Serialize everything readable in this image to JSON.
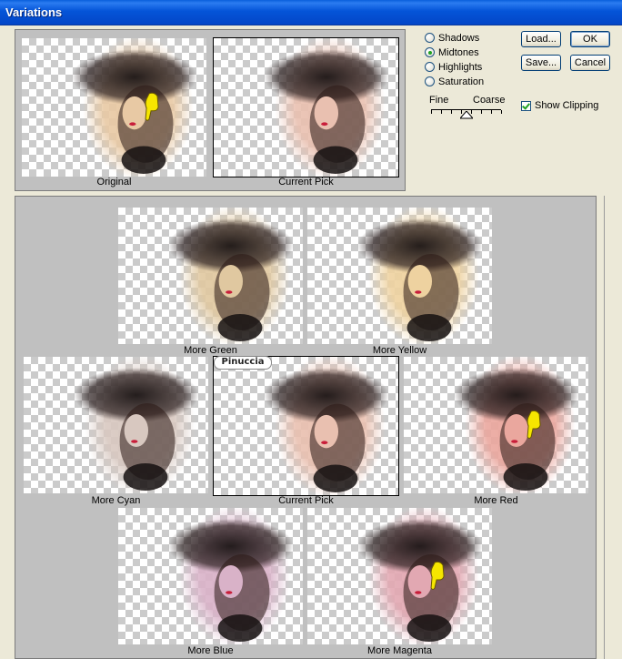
{
  "window": {
    "title": "Variations"
  },
  "preview": {
    "original_label": "Original",
    "current_pick_label": "Current Pick"
  },
  "tones": {
    "options": [
      "Shadows",
      "Midtones",
      "Highlights",
      "Saturation"
    ],
    "selected": "Midtones"
  },
  "slider": {
    "fine_label": "Fine",
    "coarse_label": "Coarse",
    "position": 0.5
  },
  "show_clipping": {
    "label": "Show Clipping",
    "checked": true
  },
  "buttons": {
    "load": "Load...",
    "ok": "OK",
    "save": "Save...",
    "cancel": "Cancel"
  },
  "variations": {
    "more_green": "More Green",
    "more_yellow": "More Yellow",
    "more_cyan": "More Cyan",
    "current_pick": "Current Pick",
    "more_red": "More Red",
    "more_blue": "More Blue",
    "more_magenta": "More Magenta"
  },
  "watermark": "Pinuccia",
  "tints": {
    "original": "#e8c9a4",
    "current": "#e9c0b0",
    "green": "#e0c8a0",
    "yellow": "#eed2a0",
    "cyan": "#d8c8c0",
    "red": "#eaa79e",
    "blue": "#d9b2c8",
    "magenta": "#e2a8b2"
  }
}
